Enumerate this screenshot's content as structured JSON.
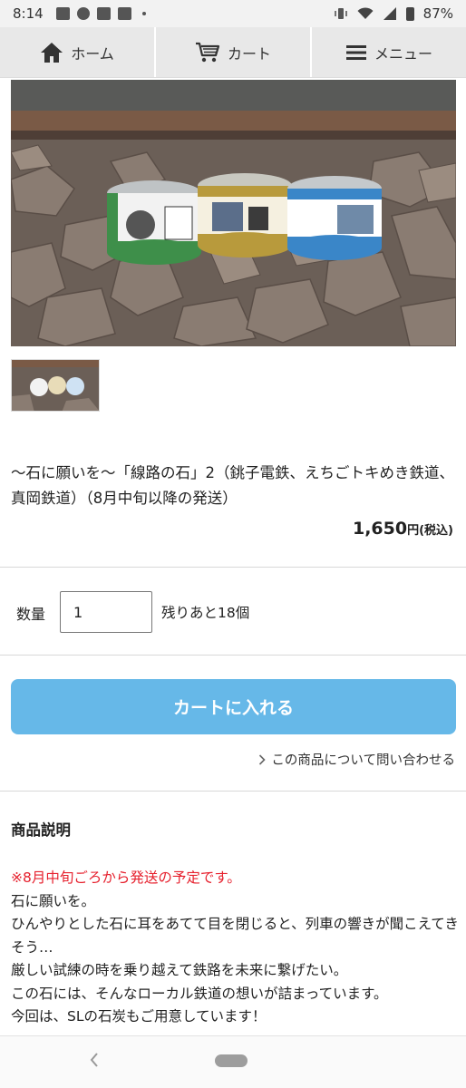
{
  "status_bar": {
    "time": "8:14",
    "battery": "87%",
    "icons": [
      "image-icon",
      "pokeball-icon",
      "youtube-icon",
      "cat-icon",
      "dot-icon",
      "vibrate-icon",
      "wifi-icon",
      "signal-icon",
      "battery-icon"
    ]
  },
  "nav": {
    "home_label": "ホーム",
    "cart_label": "カート",
    "menu_label": "メニュー"
  },
  "product": {
    "title": "〜石に願いを〜「線路の石」2（銚子電鉄、えちごトキめき鉄道、真岡鉄道）（8月中旬以降の発送）",
    "price": "1,650",
    "price_unit": "円",
    "tax_note": "(税込)",
    "quantity_label": "数量",
    "quantity_value": "1",
    "stock_text": "残りあと18個",
    "cart_button": "カートに入れる",
    "inquiry_link": "この商品について問い合わせる"
  },
  "description": {
    "heading": "商品説明",
    "notice": "※8月中旬ごろから発送の予定です。",
    "lines": [
      "石に願いを。",
      "ひんやりとした石に耳をあてて目を閉じると、列車の響きが聞こえてきそう…",
      "厳しい試練の時を乗り越えて鉄路を未来に繋げたい。",
      "この石には、そんなローカル鉄道の想いが詰まっています。",
      "今回は、SLの石炭もご用意しています！"
    ]
  },
  "colors": {
    "accent": "#66b8e8",
    "notice": "#e6202d",
    "nav_bg": "#e8e8e8"
  }
}
